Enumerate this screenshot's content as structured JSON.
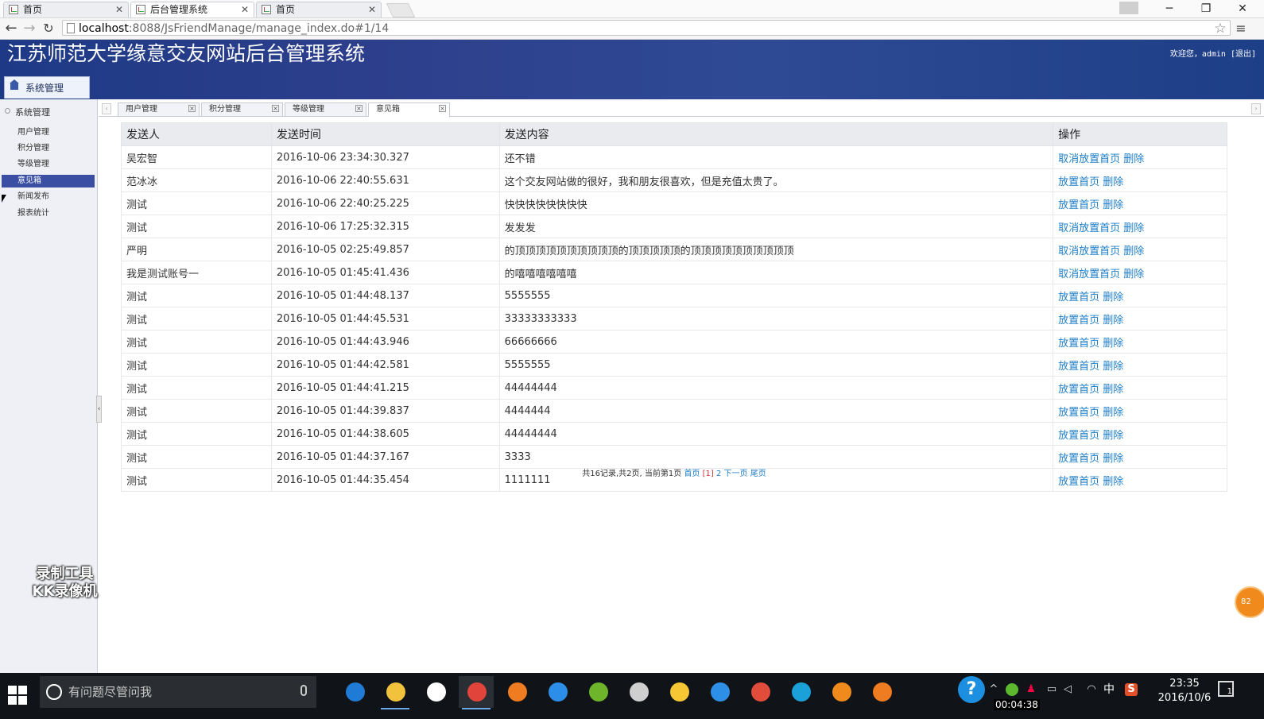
{
  "browser": {
    "tabs": [
      {
        "title": "首页",
        "active": false
      },
      {
        "title": "后台管理系统",
        "active": true
      },
      {
        "title": "首页",
        "active": false
      }
    ],
    "address": {
      "host": "localhost",
      "rest": ":8088/JsFriendManage/manage_index.do#1/14"
    }
  },
  "header": {
    "title": "江苏师范大学缘意交友网站后台管理系统",
    "welcome": "欢迎您，admin [退出]",
    "section_tab": "系统管理"
  },
  "sidebar": {
    "heading": "系统管理",
    "items": [
      {
        "label": "用户管理",
        "active": false
      },
      {
        "label": "积分管理",
        "active": false
      },
      {
        "label": "等级管理",
        "active": false
      },
      {
        "label": "意见箱",
        "active": true
      },
      {
        "label": "新闻发布",
        "active": false
      },
      {
        "label": "报表统计",
        "active": false
      }
    ]
  },
  "content_tabs": [
    {
      "label": "用户管理",
      "active": false
    },
    {
      "label": "积分管理",
      "active": false
    },
    {
      "label": "等级管理",
      "active": false
    },
    {
      "label": "意见箱",
      "active": true
    }
  ],
  "table": {
    "headers": [
      "发送人",
      "发送时间",
      "发送内容",
      "操作"
    ],
    "rows": [
      {
        "sender": "吴宏智",
        "time": "2016-10-06 23:34:30.327",
        "content": "还不错",
        "ops": [
          "取消放置首页",
          "删除"
        ]
      },
      {
        "sender": "范冰冰",
        "time": "2016-10-06 22:40:55.631",
        "content": "这个交友网站做的很好，我和朋友很喜欢，但是充值太贵了。",
        "ops": [
          "放置首页",
          "删除"
        ]
      },
      {
        "sender": "测试",
        "time": "2016-10-06 22:40:25.225",
        "content": "快快快快快快快快",
        "ops": [
          "放置首页",
          "删除"
        ]
      },
      {
        "sender": "测试",
        "time": "2016-10-06 17:25:32.315",
        "content": "发发发",
        "ops": [
          "取消放置首页",
          "删除"
        ]
      },
      {
        "sender": "严明",
        "time": "2016-10-05 02:25:49.857",
        "content": "的顶顶顶顶顶顶顶顶顶顶的顶顶顶顶顶的顶顶顶顶顶顶顶顶顶顶",
        "ops": [
          "取消放置首页",
          "删除"
        ]
      },
      {
        "sender": "我是测试账号一",
        "time": "2016-10-05 01:45:41.436",
        "content": "的嘻嘻嘻嘻嘻嘻",
        "ops": [
          "取消放置首页",
          "删除"
        ]
      },
      {
        "sender": "测试",
        "time": "2016-10-05 01:44:48.137",
        "content": "5555555",
        "ops": [
          "放置首页",
          "删除"
        ]
      },
      {
        "sender": "测试",
        "time": "2016-10-05 01:44:45.531",
        "content": "33333333333",
        "ops": [
          "放置首页",
          "删除"
        ]
      },
      {
        "sender": "测试",
        "time": "2016-10-05 01:44:43.946",
        "content": "66666666",
        "ops": [
          "放置首页",
          "删除"
        ]
      },
      {
        "sender": "测试",
        "time": "2016-10-05 01:44:42.581",
        "content": "5555555",
        "ops": [
          "放置首页",
          "删除"
        ]
      },
      {
        "sender": "测试",
        "time": "2016-10-05 01:44:41.215",
        "content": "44444444",
        "ops": [
          "放置首页",
          "删除"
        ]
      },
      {
        "sender": "测试",
        "time": "2016-10-05 01:44:39.837",
        "content": "4444444",
        "ops": [
          "放置首页",
          "删除"
        ]
      },
      {
        "sender": "测试",
        "time": "2016-10-05 01:44:38.605",
        "content": "44444444",
        "ops": [
          "放置首页",
          "删除"
        ]
      },
      {
        "sender": "测试",
        "time": "2016-10-05 01:44:37.167",
        "content": "3333",
        "ops": [
          "放置首页",
          "删除"
        ]
      },
      {
        "sender": "测试",
        "time": "2016-10-05 01:44:35.454",
        "content": "1111111",
        "ops": [
          "放置首页",
          "删除"
        ]
      }
    ]
  },
  "pager": {
    "summary": "共16记录,共2页, 当前第1页 ",
    "first": "首页",
    "current": "[1]",
    "page2": "2",
    "next": "下一页",
    "last": "尾页"
  },
  "watermark": {
    "line1": "录制工具",
    "line2": "KK录像机"
  },
  "float_badge": "82",
  "taskbar": {
    "search_placeholder": "有问题尽管问我",
    "clock_time": "23:35",
    "clock_date": "2016/10/6",
    "rec_timer": "00:04:38",
    "ime": "中",
    "notification_count": "1",
    "apps": [
      {
        "icon": "edge-icon",
        "color": "#1f7bd6"
      },
      {
        "icon": "file-explorer-icon",
        "color": "#f3c23c"
      },
      {
        "icon": "store-icon",
        "color": "#ffffff"
      },
      {
        "icon": "chrome-icon",
        "color": "#e0443a"
      },
      {
        "icon": "firefox-icon",
        "color": "#f07c21"
      },
      {
        "icon": "sogou-browser-icon",
        "color": "#2c8ee8"
      },
      {
        "icon": "spring-tool-icon",
        "color": "#6fb52c"
      },
      {
        "icon": "settings-gear-icon",
        "color": "#cfcfcf"
      },
      {
        "icon": "qq-icon",
        "color": "#f6c634"
      },
      {
        "icon": "wps-writer-icon",
        "color": "#2d8fe6"
      },
      {
        "icon": "pdf-tool-icon",
        "color": "#e24c3b"
      },
      {
        "icon": "kk-recorder-icon",
        "color": "#1ba0d8"
      },
      {
        "icon": "sunglasses-app-icon",
        "color": "#f08a1c"
      },
      {
        "icon": "firefox-icon",
        "color": "#f07c21"
      }
    ]
  },
  "colors": {
    "header": "#2d3f8c",
    "sidebar_active": "#3a4fa4",
    "link": "#1e7ec8"
  }
}
